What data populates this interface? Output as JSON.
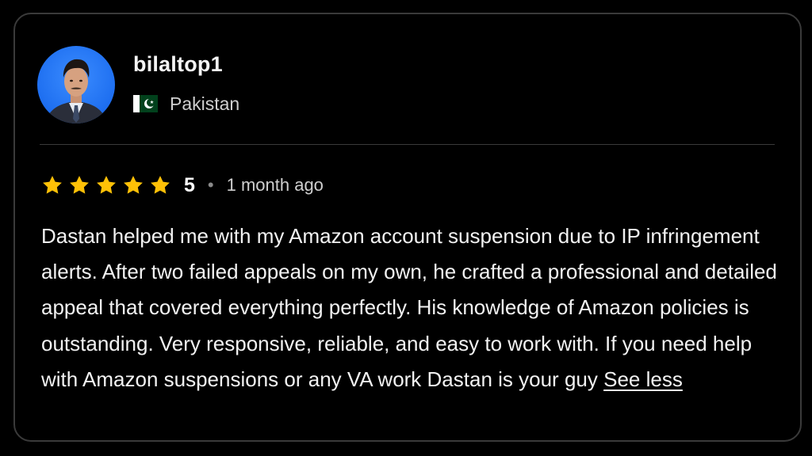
{
  "reviewer": {
    "username": "bilaltop1",
    "country": "Pakistan",
    "flag_icon": "pakistan-flag-icon",
    "avatar_icon": "avatar"
  },
  "rating": {
    "stars": 5,
    "value": "5",
    "separator": "•",
    "time_ago": "1 month ago",
    "star_color": "#ffc107"
  },
  "review": {
    "text": "Dastan helped me with my Amazon account suspension due to IP infringement alerts. After two failed appeals on my own, he crafted a professional and detailed appeal that covered everything perfectly. His knowledge of Amazon policies is outstanding. Very responsive, reliable, and easy to work with. If you need help with Amazon suspensions or any VA work Dastan is your guy",
    "toggle_label": "See less"
  },
  "colors": {
    "background": "#000000",
    "card_border": "#3a3a3a",
    "text": "#f2f2f2",
    "muted_text": "#cfcfcf"
  }
}
